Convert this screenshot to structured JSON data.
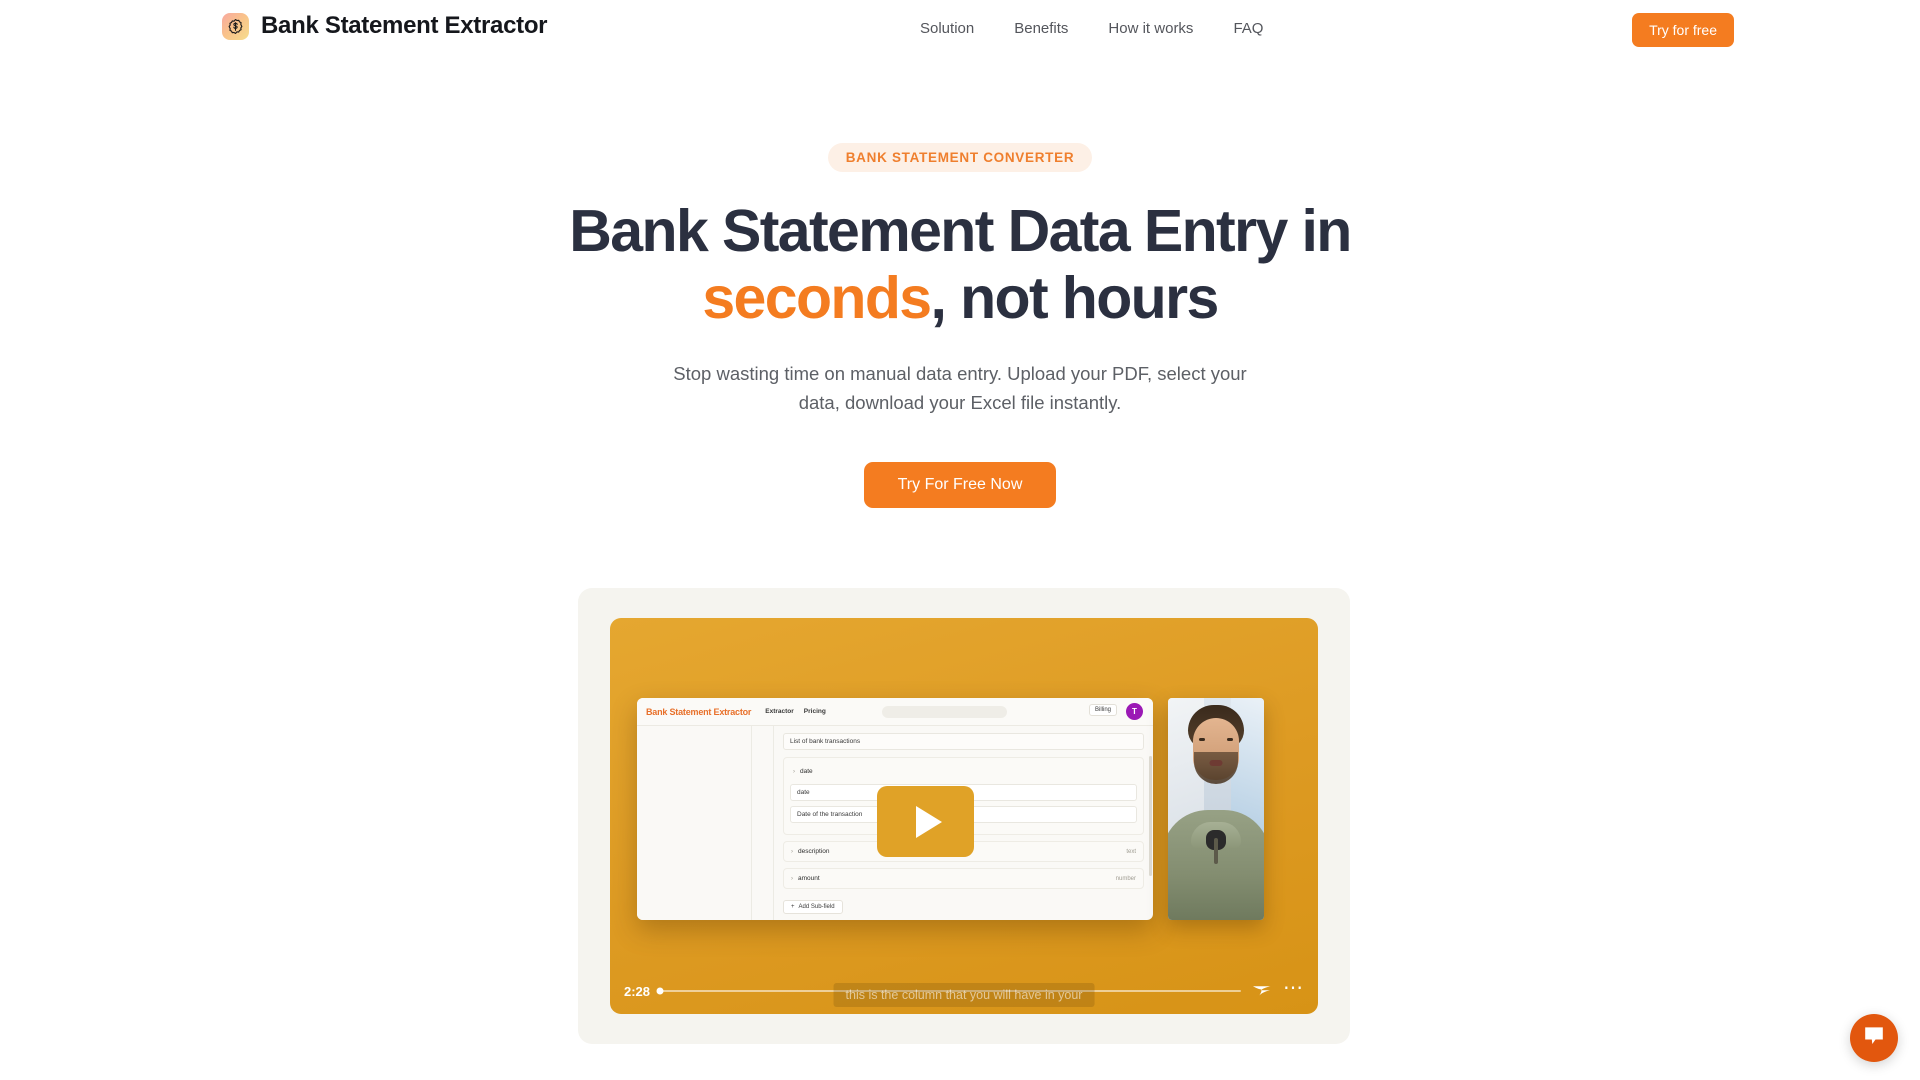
{
  "header": {
    "brand_name": "Bank Statement Extractor",
    "brand_logo_icon": "dollar-badge-icon",
    "nav": [
      {
        "label": "Solution"
      },
      {
        "label": "Benefits"
      },
      {
        "label": "How it works"
      },
      {
        "label": "FAQ"
      }
    ],
    "cta_label": "Try for free"
  },
  "hero": {
    "eyebrow": "BANK STATEMENT CONVERTER",
    "headline_line1": "Bank Statement Data Entry in",
    "headline_accent": "seconds",
    "headline_rest": ", not hours",
    "subhead": "Stop wasting time on manual data entry. Upload your PDF, select your data, download your Excel file instantly.",
    "cta_label": "Try For Free Now"
  },
  "video": {
    "time": "2:28",
    "caption": "this is the column that you will have in your",
    "play_icon": "play-icon",
    "brand_mark_icon": "loom-logo-icon",
    "more_icon": "more-options-icon",
    "app": {
      "logo": "Bank Statement Extractor",
      "nav": [
        {
          "label": "Extractor"
        },
        {
          "label": "Pricing"
        }
      ],
      "billing_label": "Billing",
      "avatar_initial": "T",
      "field_title": "List of bank transactions",
      "fields": [
        {
          "name": "date",
          "type": ""
        },
        {
          "name": "description",
          "type": "text"
        },
        {
          "name": "amount",
          "type": "number"
        }
      ],
      "date_input_value": "date",
      "date_description_value": "Date of the transaction",
      "add_subfield_label": "Add Sub-field"
    }
  },
  "chat": {
    "icon": "chat-bubble-icon"
  },
  "colors": {
    "accent_orange": "#f47c20",
    "headline_navy": "#2b3040",
    "video_amber": "#e0a227",
    "eyebrow_bg": "#fdf0e6",
    "card_bg": "#f5f4ef",
    "chat_orange": "#e2570e",
    "avatar_purple": "#9b19b5"
  }
}
